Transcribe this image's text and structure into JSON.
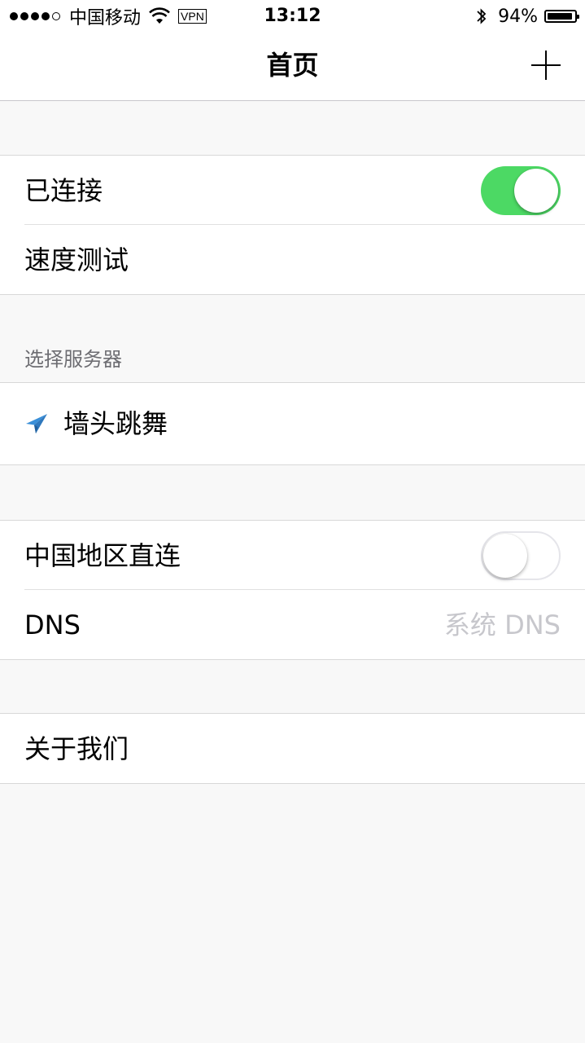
{
  "status_bar": {
    "carrier": "中国移动",
    "vpn_label": "VPN",
    "time": "13:12",
    "battery_percent": "94%",
    "battery_level": 0.94,
    "signal_bars_filled": 4,
    "signal_bars_total": 5
  },
  "nav": {
    "title": "首页"
  },
  "connection": {
    "connected_label": "已连接",
    "connected_on": true,
    "speed_test_label": "速度测试"
  },
  "server": {
    "header": "选择服务器",
    "selected_name": "墙头跳舞"
  },
  "routing": {
    "china_direct_label": "中国地区直连",
    "china_direct_on": false,
    "dns_label": "DNS",
    "dns_value": "系统 DNS"
  },
  "about": {
    "label": "关于我们"
  },
  "colors": {
    "toggle_on": "#4cd964",
    "plane_icon": "#3a8fd8",
    "background": "#f8f8f8"
  }
}
